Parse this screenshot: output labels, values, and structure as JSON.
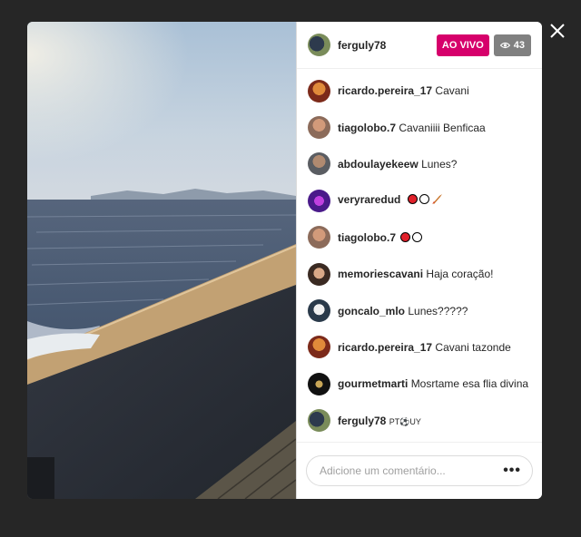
{
  "header": {
    "username": "ferguly78",
    "live_label": "AO VIVO",
    "viewer_count": "43"
  },
  "comments": [
    {
      "user": "ricardo.pereira_17",
      "text": "Cavani"
    },
    {
      "user": "tiagolobo.7",
      "text": "Cavaniiii Benficaa"
    },
    {
      "user": "abdoulayekeew",
      "text": "Lunes?"
    },
    {
      "user": "veryraredud",
      "text": ""
    },
    {
      "user": "tiagolobo.7",
      "text": ""
    },
    {
      "user": "memoriescavani",
      "text": "Haja coração!"
    },
    {
      "user": "goncalo_mlo",
      "text": "Lunes?????"
    },
    {
      "user": "ricardo.pereira_17",
      "text": "Cavani tazonde"
    },
    {
      "user": "gourmetmarti",
      "text": "Mosrtame esa flia divina"
    },
    {
      "user": "ferguly78",
      "text": "PT⚽UY"
    }
  ],
  "comment_input": {
    "placeholder": "Adicione um comentário..."
  },
  "colors": {
    "live_badge": "#d6006b",
    "viewer_badge": "#808080",
    "backdrop": "#262626"
  },
  "icons": [
    "close-icon",
    "eye-icon",
    "more-options-icon"
  ]
}
